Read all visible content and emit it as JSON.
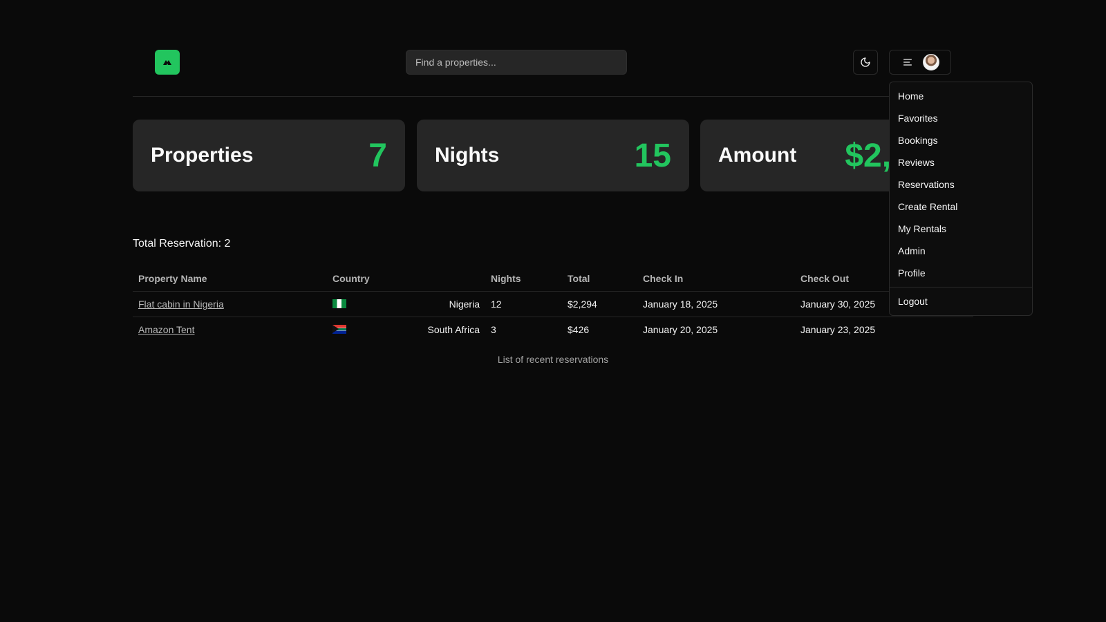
{
  "navbar": {
    "logo_icon": "tent-icon",
    "search_placeholder": "Find a properties...",
    "theme_icon": "moon-icon",
    "menu_icon": "align-left-icon"
  },
  "stats": [
    {
      "title": "Properties",
      "value": "7"
    },
    {
      "title": "Nights",
      "value": "15"
    },
    {
      "title": "Amount",
      "value": "$2,"
    }
  ],
  "reservations": {
    "total_label": "Total Reservation: 2",
    "columns": [
      "Property Name",
      "Country",
      "Nights",
      "Total",
      "Check In",
      "Check Out"
    ],
    "rows": [
      {
        "name": "Flat cabin in Nigeria",
        "flag": "nigeria-flag",
        "country": "Nigeria",
        "nights": "12",
        "total": "$2,294",
        "check_in": "January 18, 2025",
        "check_out": "January 30, 2025"
      },
      {
        "name": "Amazon Tent",
        "flag": "south-africa-flag",
        "country": "South Africa",
        "nights": "3",
        "total": "$426",
        "check_in": "January 20, 2025",
        "check_out": "January 23, 2025"
      }
    ],
    "caption": "List of recent reservations"
  },
  "dropdown": {
    "items": [
      "Home",
      "Favorites",
      "Bookings",
      "Reviews",
      "Reservations",
      "Create Rental",
      "My Rentals",
      "Admin",
      "Profile"
    ],
    "logout": "Logout"
  },
  "colors": {
    "accent": "#22c55e",
    "background": "#0a0a0a",
    "card": "#262626"
  }
}
